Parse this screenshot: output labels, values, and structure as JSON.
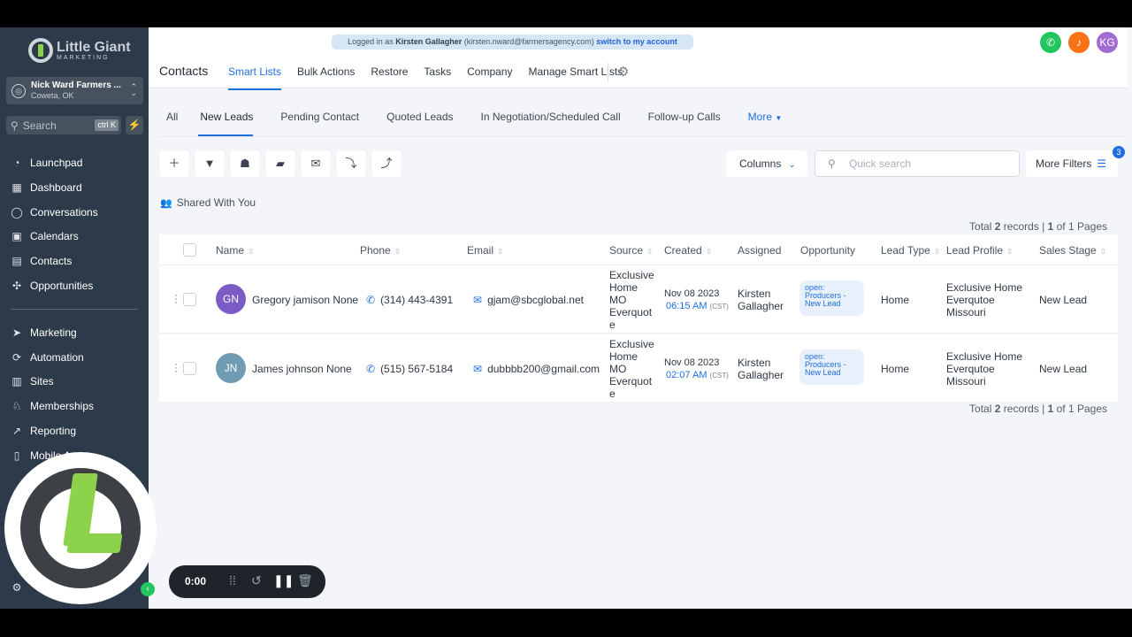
{
  "brand": {
    "name": "Little Giant",
    "tagline": "MARKETING"
  },
  "account": {
    "name": "Nick Ward Farmers ...",
    "location": "Coweta, OK"
  },
  "sidebar_search": {
    "placeholder": "Search",
    "shortcut": "ctrl K"
  },
  "nav": [
    {
      "label": "Launchpad",
      "icon": "rocket-icon"
    },
    {
      "label": "Dashboard",
      "icon": "dashboard-icon"
    },
    {
      "label": "Conversations",
      "icon": "chat-icon"
    },
    {
      "label": "Calendars",
      "icon": "calendar-icon"
    },
    {
      "label": "Contacts",
      "icon": "contacts-icon"
    },
    {
      "label": "Opportunities",
      "icon": "opportunities-icon"
    },
    {
      "label": "Marketing",
      "icon": "send-icon"
    },
    {
      "label": "Automation",
      "icon": "automation-icon"
    },
    {
      "label": "Sites",
      "icon": "sites-icon"
    },
    {
      "label": "Memberships",
      "icon": "membership-icon"
    },
    {
      "label": "Reporting",
      "icon": "reporting-icon"
    },
    {
      "label": "Mobile A",
      "icon": "mobile-icon"
    }
  ],
  "impersonation": {
    "prefix": "Logged in as",
    "user": "Kirsten Gallagher",
    "email": "(kirsten.nward@farmersagency.com)",
    "switch": "switch to my account"
  },
  "header": {
    "title": "Contacts",
    "avatar_initials": "KG",
    "tabs": [
      "Smart Lists",
      "Bulk Actions",
      "Restore",
      "Tasks",
      "Company",
      "Manage Smart Lists"
    ]
  },
  "smart_lists": [
    "All",
    "New Leads",
    "Pending Contact",
    "Quoted Leads",
    "In Negotiation/Scheduled Call",
    "Follow-up Calls"
  ],
  "more_label": "More",
  "controls": {
    "columns": "Columns",
    "quick_search_placeholder": "Quick search",
    "more_filters": "More Filters",
    "filter_count": "3"
  },
  "shared_label": "Shared With You",
  "total": {
    "prefix": "Total",
    "count": "2",
    "mid": "records |",
    "page": "1",
    "suffix": "of 1 Pages"
  },
  "columns": [
    "Name",
    "Phone",
    "Email",
    "Source",
    "Created",
    "Assigned",
    "Opportunity",
    "Lead Type",
    "Lead Profile",
    "Sales Stage"
  ],
  "rows": [
    {
      "initials": "GN",
      "avatar_color": "#7b5cc4",
      "name": "Gregory jamison None",
      "phone": "(314) 443-4391",
      "email": "gjam@sbcglobal.net",
      "source": [
        "Exclusive",
        "Home",
        "MO",
        "Everquot",
        "e"
      ],
      "created_date": "Nov 08 2023",
      "created_time": "06:15 AM",
      "tz": "(CST)",
      "assigned": [
        "Kirsten",
        "Gallagher"
      ],
      "opportunity": [
        "open:",
        "Producers -",
        "New Lead"
      ],
      "lead_type": "Home",
      "lead_profile": [
        "Exclusive Home",
        "Everqutoe",
        "Missouri"
      ],
      "sales_stage": "New Lead"
    },
    {
      "initials": "JN",
      "avatar_color": "#6f9bb3",
      "name": "James johnson None",
      "phone": "(515) 567-5184",
      "email": "dubbbb200@gmail.com",
      "source": [
        "Exclusive",
        "Home",
        "MO",
        "Everquot",
        "e"
      ],
      "created_date": "Nov 08 2023",
      "created_time": "02:07 AM",
      "tz": "(CST)",
      "assigned": [
        "Kirsten",
        "Gallagher"
      ],
      "opportunity": [
        "open:",
        "Producers -",
        "New Lead"
      ],
      "lead_type": "Home",
      "lead_profile": [
        "Exclusive Home",
        "Everqutoe",
        "Missouri"
      ],
      "sales_stage": "New Lead"
    }
  ],
  "recorder": {
    "time": "0:00"
  }
}
